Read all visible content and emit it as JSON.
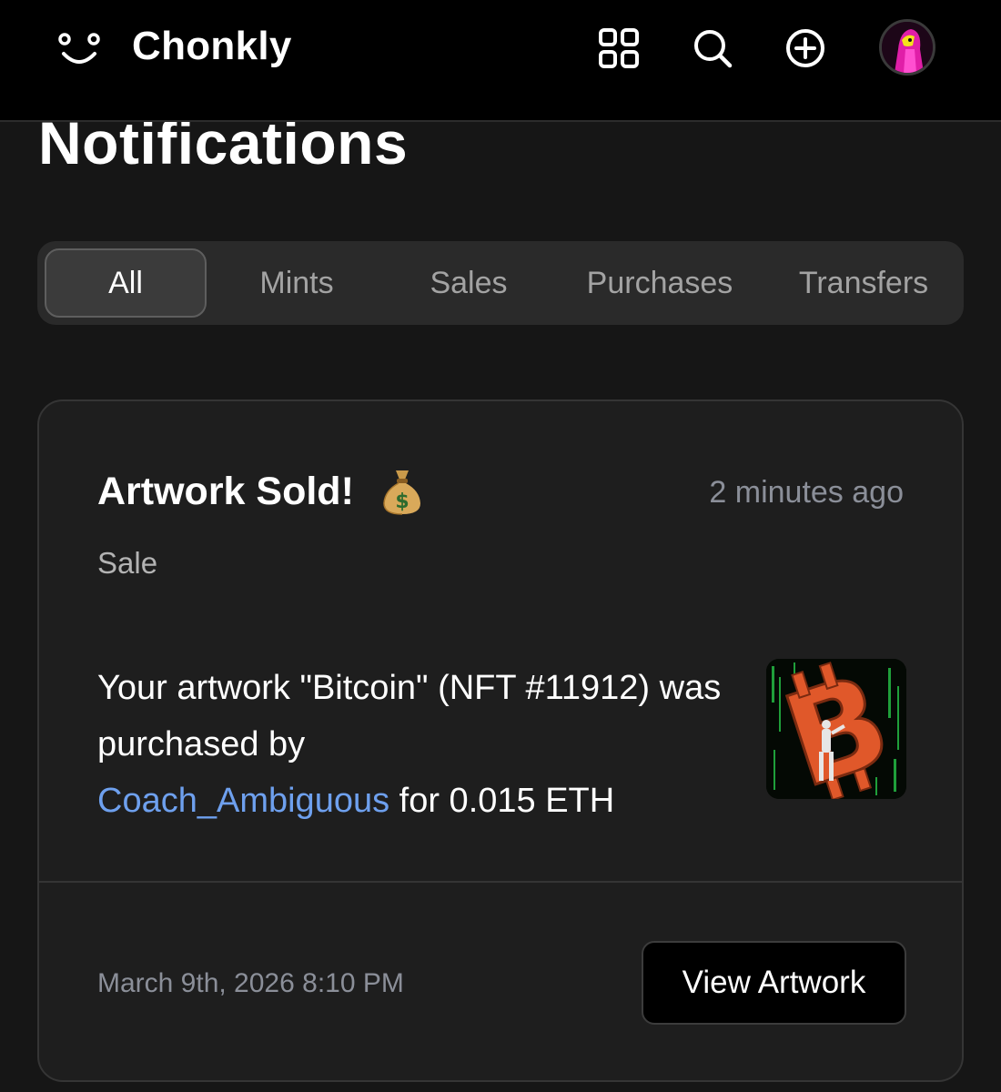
{
  "header": {
    "brand": "Chonkly",
    "icons": [
      "smiley-logo-icon",
      "grid-icon",
      "search-icon",
      "plus-circle-icon",
      "avatar"
    ]
  },
  "page": {
    "title": "Notifications"
  },
  "tabs": [
    {
      "label": "All",
      "active": true
    },
    {
      "label": "Mints",
      "active": false
    },
    {
      "label": "Sales",
      "active": false
    },
    {
      "label": "Purchases",
      "active": false
    },
    {
      "label": "Transfers",
      "active": false
    }
  ],
  "notification": {
    "title": "Artwork Sold!",
    "emoji_icon": "money-bag-icon",
    "time_ago": "2 minutes ago",
    "category": "Sale",
    "message_prefix": "Your artwork \"Bitcoin\" (NFT #11912) was purchased by",
    "buyer": "Coach_Ambiguous",
    "message_suffix": " for 0.015 ETH",
    "date": "March 9th, 2026 8:10 PM",
    "action_label": "View Artwork"
  },
  "colors": {
    "background": "#161616",
    "header": "#000000",
    "card": "#1e1e1e",
    "link": "#6ea0ee",
    "muted": "#8b8f99",
    "bitcoin_orange": "#e0582a"
  }
}
